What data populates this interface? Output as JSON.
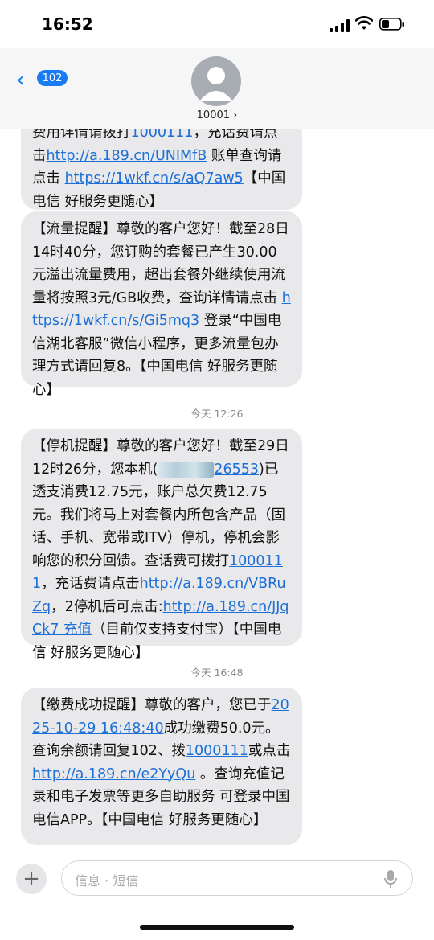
{
  "status_bar": {
    "time": "16:52"
  },
  "header": {
    "unread_count": "102",
    "contact_name": "10001 ›"
  },
  "thread": {
    "msg1": {
      "line1": "费用详情请拨打",
      "link1": "1000111",
      "line1b": "，充话费请点击",
      "link2": "http://a.189.cn/UNIMfB",
      "line2": "账单查询请点击",
      "link3": "https://1wkf.cn/s/aQ7aw5",
      "line3": "【中国电信 好服务更随心】"
    },
    "msg2": {
      "text1": "【流量提醒】尊敬的客户您好！截至28日14时40分，您订购的套餐已产生30.00元溢出流量费用，超出套餐外继续使用流量将按照3元/GB收费，查询详情请点击",
      "link1": "https://1wkf.cn/s/Gi5mq3",
      "text2": "登录“中国电信湖北客服”微信小程序，更多流量包办理方式请回复8。【中国电信 好服务更随心】"
    },
    "ts1": "今天 12:26",
    "msg3": {
      "text1": "【停机提醒】尊敬的客户您好！截至29日12时26分，您本机(",
      "masked_number_tail": "26553",
      "text2": ")已透支消费12.75元，账户总欠费12.75元。我们将马上对套餐内所包含产品（固话、手机、宽带或ITV）停机，停机会影响您的积分回馈。查话费可拨打",
      "link1": "1000111",
      "text3": "，充话费请点击",
      "link2": "http://a.189.cn/VBRuZq",
      "text4": "，2停机后可点击:",
      "link3": "http://a.189.cn/JJqCk7 充值",
      "text5": "（目前仅支持支付宝）【中国电信 好服务更随心】"
    },
    "ts2": "今天 16:48",
    "msg4": {
      "text1": "【缴费成功提醒】尊敬的客户，您已于",
      "link_date": "2025-10-29 16:48:40",
      "text2": "成功缴费50.0元。查询余额请回复102、拨",
      "link1": "1000111",
      "text3": "或点击",
      "link2": "http://a.189.cn/e2YyQu",
      "text4": "。查询充值记录和电子发票等更多自助服务 可登录中国电信APP。【中国电信 好服务更随心】"
    }
  },
  "composer": {
    "placeholder": "信息 · 短信"
  },
  "colors": {
    "accent": "#1a7cf5",
    "bubble": "#e9e9eb",
    "link": "#1b6fd6"
  }
}
